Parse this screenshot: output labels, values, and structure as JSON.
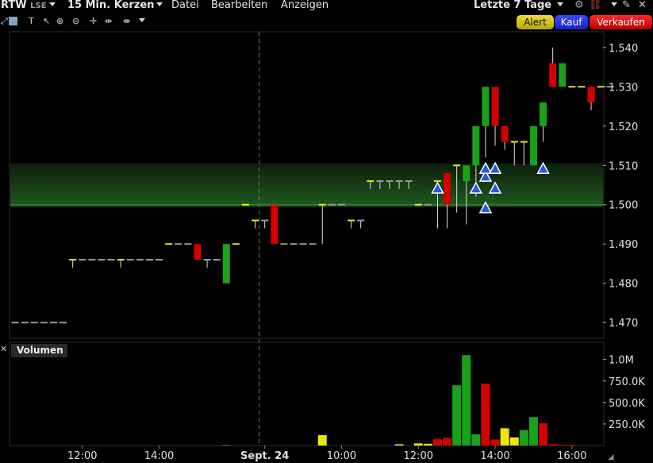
{
  "header": {
    "symbol": "RTW",
    "exchange": "LSE",
    "interval": "15 Min. Kerzen",
    "menu": [
      "Datei",
      "Bearbeiten",
      "Anzeigen"
    ],
    "range": "Letzte 7 Tage"
  },
  "buttons": {
    "alert": "Alert",
    "buy": "Kauf",
    "sell": "Verkaufen"
  },
  "volume_label": "Volumen",
  "colors": {
    "up": "#1aa11a",
    "down": "#d30000",
    "flat": "#9a9a9a",
    "yellow": "#e8e800",
    "band": "#1c4a1c",
    "marker": "#2a5bd7"
  },
  "chart_data": [
    {
      "type": "candlestick",
      "title": "",
      "xlabel": "",
      "ylabel": "",
      "x_tick_labels": [
        "12:00",
        "14:00",
        "Sept. 24",
        "10:00",
        "12:00",
        "14:00",
        "16:00"
      ],
      "y_ticks": [
        "1.540",
        "1.530",
        "1.520",
        "1.510",
        "1.500",
        "1.490",
        "1.480",
        "1.470"
      ],
      "ylim": [
        1.466,
        1.544
      ],
      "highlight_band": [
        1.4995,
        1.5105
      ],
      "day_separator_after_bar": 25,
      "candles": [
        {
          "o": 1.47,
          "h": 1.47,
          "l": 1.47,
          "c": 1.47,
          "col": "flat"
        },
        {
          "o": 1.47,
          "h": 1.47,
          "l": 1.47,
          "c": 1.47,
          "col": "flat"
        },
        {
          "o": 1.47,
          "h": 1.47,
          "l": 1.47,
          "c": 1.47,
          "col": "flat"
        },
        {
          "o": 1.47,
          "h": 1.47,
          "l": 1.47,
          "c": 1.47,
          "col": "flat"
        },
        {
          "o": 1.47,
          "h": 1.47,
          "l": 1.47,
          "c": 1.47,
          "col": "flat"
        },
        {
          "o": 1.47,
          "h": 1.47,
          "l": 1.47,
          "c": 1.47,
          "col": "flat"
        },
        {
          "o": 1.486,
          "h": 1.486,
          "l": 1.484,
          "c": 1.486,
          "col": "yellow"
        },
        {
          "o": 1.486,
          "h": 1.486,
          "l": 1.486,
          "c": 1.486,
          "col": "flat"
        },
        {
          "o": 1.486,
          "h": 1.486,
          "l": 1.486,
          "c": 1.486,
          "col": "flat"
        },
        {
          "o": 1.486,
          "h": 1.486,
          "l": 1.486,
          "c": 1.486,
          "col": "flat"
        },
        {
          "o": 1.486,
          "h": 1.486,
          "l": 1.486,
          "c": 1.486,
          "col": "flat"
        },
        {
          "o": 1.486,
          "h": 1.486,
          "l": 1.484,
          "c": 1.486,
          "col": "yellow"
        },
        {
          "o": 1.486,
          "h": 1.486,
          "l": 1.486,
          "c": 1.486,
          "col": "flat"
        },
        {
          "o": 1.486,
          "h": 1.486,
          "l": 1.486,
          "c": 1.486,
          "col": "flat"
        },
        {
          "o": 1.486,
          "h": 1.486,
          "l": 1.486,
          "c": 1.486,
          "col": "flat"
        },
        {
          "o": 1.486,
          "h": 1.486,
          "l": 1.486,
          "c": 1.486,
          "col": "flat"
        },
        {
          "o": 1.49,
          "h": 1.49,
          "l": 1.49,
          "c": 1.49,
          "col": "yellow"
        },
        {
          "o": 1.49,
          "h": 1.49,
          "l": 1.49,
          "c": 1.49,
          "col": "flat"
        },
        {
          "o": 1.49,
          "h": 1.49,
          "l": 1.49,
          "c": 1.49,
          "col": "flat"
        },
        {
          "o": 1.49,
          "h": 1.49,
          "l": 1.486,
          "c": 1.486,
          "col": "down"
        },
        {
          "o": 1.486,
          "h": 1.486,
          "l": 1.484,
          "c": 1.486,
          "col": "flat"
        },
        {
          "o": 1.486,
          "h": 1.486,
          "l": 1.486,
          "c": 1.486,
          "col": "flat"
        },
        {
          "o": 1.48,
          "h": 1.49,
          "l": 1.48,
          "c": 1.49,
          "col": "up"
        },
        {
          "o": 1.49,
          "h": 1.49,
          "l": 1.49,
          "c": 1.49,
          "col": "yellow"
        },
        {
          "o": 1.5,
          "h": 1.5,
          "l": 1.5,
          "c": 1.5,
          "col": "yellow"
        },
        {
          "o": 1.496,
          "h": 1.496,
          "l": 1.494,
          "c": 1.496,
          "col": "yellow"
        },
        {
          "o": 1.496,
          "h": 1.496,
          "l": 1.494,
          "c": 1.496,
          "col": "flat"
        },
        {
          "o": 1.5,
          "h": 1.5,
          "l": 1.49,
          "c": 1.49,
          "col": "down"
        },
        {
          "o": 1.49,
          "h": 1.49,
          "l": 1.49,
          "c": 1.49,
          "col": "flat"
        },
        {
          "o": 1.49,
          "h": 1.49,
          "l": 1.49,
          "c": 1.49,
          "col": "flat"
        },
        {
          "o": 1.49,
          "h": 1.49,
          "l": 1.49,
          "c": 1.49,
          "col": "flat"
        },
        {
          "o": 1.49,
          "h": 1.49,
          "l": 1.49,
          "c": 1.49,
          "col": "flat"
        },
        {
          "o": 1.5,
          "h": 1.5,
          "l": 1.49,
          "c": 1.5,
          "col": "yellow"
        },
        {
          "o": 1.5,
          "h": 1.5,
          "l": 1.5,
          "c": 1.5,
          "col": "flat"
        },
        {
          "o": 1.5,
          "h": 1.5,
          "l": 1.5,
          "c": 1.5,
          "col": "flat"
        },
        {
          "o": 1.496,
          "h": 1.496,
          "l": 1.494,
          "c": 1.496,
          "col": "yellow"
        },
        {
          "o": 1.496,
          "h": 1.496,
          "l": 1.494,
          "c": 1.496,
          "col": "flat"
        },
        {
          "o": 1.506,
          "h": 1.506,
          "l": 1.504,
          "c": 1.506,
          "col": "yellow"
        },
        {
          "o": 1.506,
          "h": 1.506,
          "l": 1.504,
          "c": 1.506,
          "col": "flat"
        },
        {
          "o": 1.506,
          "h": 1.506,
          "l": 1.504,
          "c": 1.506,
          "col": "flat"
        },
        {
          "o": 1.506,
          "h": 1.506,
          "l": 1.504,
          "c": 1.506,
          "col": "flat"
        },
        {
          "o": 1.506,
          "h": 1.506,
          "l": 1.504,
          "c": 1.506,
          "col": "flat"
        },
        {
          "o": 1.5,
          "h": 1.5,
          "l": 1.5,
          "c": 1.5,
          "col": "yellow"
        },
        {
          "o": 1.5,
          "h": 1.5,
          "l": 1.5,
          "c": 1.5,
          "col": "flat"
        },
        {
          "o": 1.506,
          "h": 1.506,
          "l": 1.494,
          "c": 1.506,
          "col": "yellow"
        },
        {
          "o": 1.508,
          "h": 1.508,
          "l": 1.494,
          "c": 1.5,
          "col": "down"
        },
        {
          "o": 1.51,
          "h": 1.51,
          "l": 1.498,
          "c": 1.51,
          "col": "yellow"
        },
        {
          "o": 1.506,
          "h": 1.51,
          "l": 1.495,
          "c": 1.51,
          "col": "up"
        },
        {
          "o": 1.51,
          "h": 1.52,
          "l": 1.502,
          "c": 1.52,
          "col": "up"
        },
        {
          "o": 1.52,
          "h": 1.53,
          "l": 1.512,
          "c": 1.53,
          "col": "up"
        },
        {
          "o": 1.53,
          "h": 1.53,
          "l": 1.515,
          "c": 1.52,
          "col": "down"
        },
        {
          "o": 1.52,
          "h": 1.52,
          "l": 1.514,
          "c": 1.516,
          "col": "down"
        },
        {
          "o": 1.516,
          "h": 1.516,
          "l": 1.51,
          "c": 1.516,
          "col": "yellow"
        },
        {
          "o": 1.516,
          "h": 1.516,
          "l": 1.51,
          "c": 1.516,
          "col": "yellow"
        },
        {
          "o": 1.51,
          "h": 1.52,
          "l": 1.51,
          "c": 1.52,
          "col": "up"
        },
        {
          "o": 1.52,
          "h": 1.526,
          "l": 1.516,
          "c": 1.526,
          "col": "up"
        },
        {
          "o": 1.536,
          "h": 1.54,
          "l": 1.53,
          "c": 1.53,
          "col": "down"
        },
        {
          "o": 1.53,
          "h": 1.536,
          "l": 1.53,
          "c": 1.536,
          "col": "up"
        },
        {
          "o": 1.53,
          "h": 1.53,
          "l": 1.53,
          "c": 1.53,
          "col": "yellow"
        },
        {
          "o": 1.53,
          "h": 1.53,
          "l": 1.53,
          "c": 1.53,
          "col": "yellow"
        },
        {
          "o": 1.53,
          "h": 1.53,
          "l": 1.524,
          "c": 1.526,
          "col": "down"
        },
        {
          "o": 1.53,
          "h": 1.53,
          "l": 1.53,
          "c": 1.53,
          "col": "yellow"
        },
        {
          "o": 1.53,
          "h": 1.53,
          "l": 1.53,
          "c": 1.53,
          "col": "flat"
        }
      ],
      "trade_markers": [
        {
          "bar": 44,
          "price": 1.504
        },
        {
          "bar": 48,
          "price": 1.504
        },
        {
          "bar": 49,
          "price": 1.499
        },
        {
          "bar": 49,
          "price": 1.507
        },
        {
          "bar": 49,
          "price": 1.509
        },
        {
          "bar": 50,
          "price": 1.504
        },
        {
          "bar": 50,
          "price": 1.509
        },
        {
          "bar": 55,
          "price": 1.509
        }
      ]
    },
    {
      "type": "bar",
      "title": "Volumen",
      "y_ticks": [
        "1.0M",
        "750.0K",
        "500.0K",
        "250.0K"
      ],
      "ylim": [
        0,
        1200000
      ],
      "volumes": [
        {
          "bar": 22,
          "v": 8000,
          "col": "up"
        },
        {
          "bar": 32,
          "v": 120000,
          "col": "yellow"
        },
        {
          "bar": 40,
          "v": 15000,
          "col": "yellow"
        },
        {
          "bar": 42,
          "v": 25000,
          "col": "yellow"
        },
        {
          "bar": 43,
          "v": 20000,
          "col": "yellow"
        },
        {
          "bar": 44,
          "v": 75000,
          "col": "down"
        },
        {
          "bar": 45,
          "v": 90000,
          "col": "down"
        },
        {
          "bar": 46,
          "v": 700000,
          "col": "up"
        },
        {
          "bar": 47,
          "v": 1050000,
          "col": "up"
        },
        {
          "bar": 48,
          "v": 130000,
          "col": "up"
        },
        {
          "bar": 49,
          "v": 720000,
          "col": "down"
        },
        {
          "bar": 50,
          "v": 70000,
          "col": "down"
        },
        {
          "bar": 51,
          "v": 200000,
          "col": "yellow"
        },
        {
          "bar": 52,
          "v": 95000,
          "col": "yellow"
        },
        {
          "bar": 53,
          "v": 180000,
          "col": "up"
        },
        {
          "bar": 54,
          "v": 330000,
          "col": "up"
        },
        {
          "bar": 55,
          "v": 260000,
          "col": "down"
        },
        {
          "bar": 56,
          "v": 15000,
          "col": "down"
        },
        {
          "bar": 57,
          "v": 8000,
          "col": "down"
        },
        {
          "bar": 58,
          "v": 8000,
          "col": "down"
        }
      ]
    }
  ]
}
